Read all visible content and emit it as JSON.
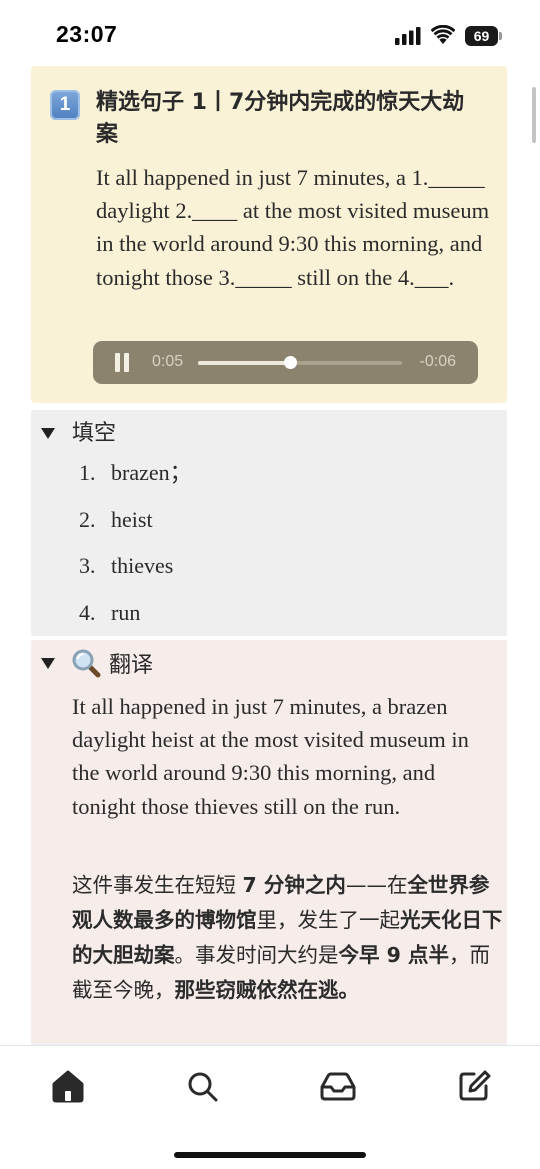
{
  "status_bar": {
    "time": "23:07",
    "battery": "69"
  },
  "sentence_card": {
    "badge": "1",
    "title": "精选句子 1丨7分钟内完成的惊天大劫案",
    "sentence": "It all happened in just 7 minutes, a 1._____ daylight 2.____ at the most visited museum in the world around 9:30 this morning, and tonight those 3._____ still on the 4.___.",
    "audio": {
      "elapsed": "0:05",
      "remaining": "-0:06",
      "progress_fraction": 0.45,
      "state": "playing"
    }
  },
  "fill_section": {
    "label": "填空",
    "answers": [
      {
        "num": "1.",
        "text": "brazen；"
      },
      {
        "num": "2.",
        "text": "heist"
      },
      {
        "num": "3.",
        "text": "thieves"
      },
      {
        "num": "4.",
        "text": "run"
      }
    ]
  },
  "translate_section": {
    "label": "翻译",
    "english": "It all happened in just 7 minutes, a brazen daylight heist at the most visited museum in the world around 9:30 this morning, and tonight those thieves still on the run.",
    "chinese": [
      {
        "text": "这件事发生在短短 ",
        "bold": false
      },
      {
        "text": "7 分钟之内",
        "bold": true
      },
      {
        "text": "——在",
        "bold": false
      },
      {
        "text": "全世界参观人数最多的博物馆",
        "bold": true
      },
      {
        "text": "里，发生了一起",
        "bold": false
      },
      {
        "text": "光天化日下的大胆劫案",
        "bold": true
      },
      {
        "text": "。事发时间大约是",
        "bold": false
      },
      {
        "text": "今早 9 点半",
        "bold": true
      },
      {
        "text": "，而截至今晚，",
        "bold": false
      },
      {
        "text": "那些窃贼依然在逃",
        "bold": true
      },
      {
        "text": "。",
        "bold": true
      }
    ]
  },
  "tab_bar": {
    "tabs": [
      {
        "name": "home",
        "icon": "home-icon"
      },
      {
        "name": "search",
        "icon": "search-icon"
      },
      {
        "name": "inbox",
        "icon": "inbox-icon"
      },
      {
        "name": "compose",
        "icon": "compose-icon"
      }
    ]
  }
}
